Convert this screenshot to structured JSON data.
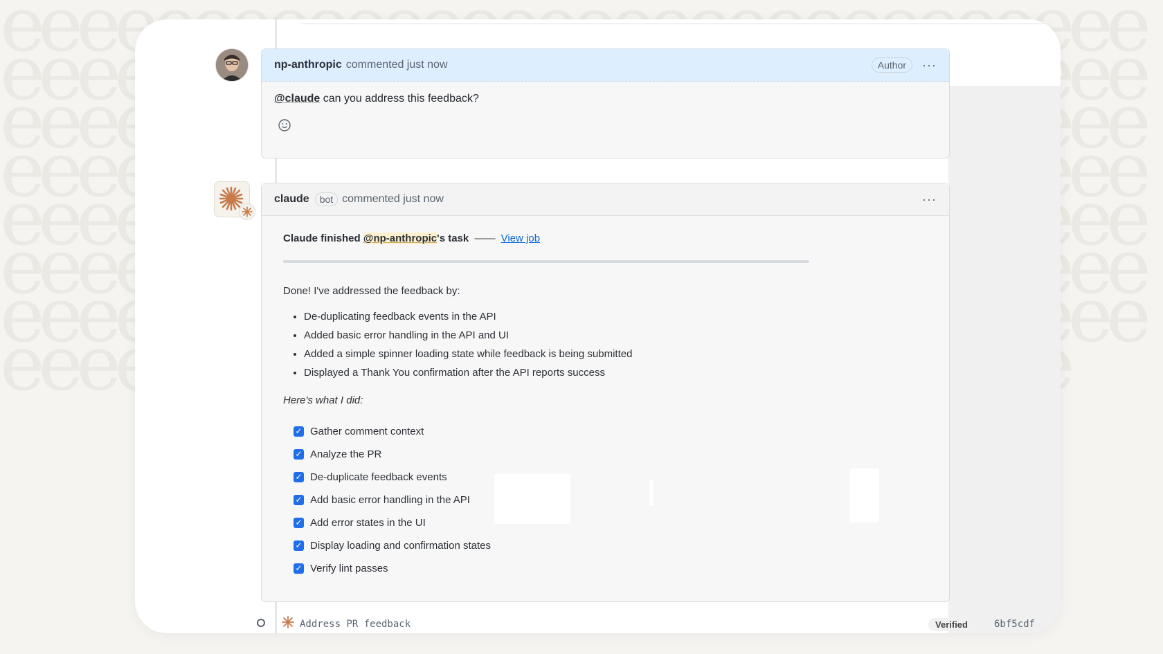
{
  "comment1": {
    "author": "np-anthropic",
    "meta": "commented just now",
    "role_badge": "Author",
    "more_label": "···",
    "mention": "@claude",
    "text": " can you address this feedback?",
    "reaction_icon": "smiley-icon"
  },
  "comment2": {
    "author": "claude",
    "bot_label": "bot",
    "meta": "commented just now",
    "more_label": "···",
    "finished_prefix": "Claude finished ",
    "finished_mention": "@np-anthropic",
    "finished_suffix": "'s task",
    "dash": "——",
    "view_job": "View job",
    "done_text": "Done! I've addressed the feedback by:",
    "bullets": [
      "De-duplicating feedback events in the API",
      "Added basic error handling in the API and UI",
      "Added a simple spinner loading state while feedback is being submitted",
      "Displayed a Thank You confirmation after the API reports success"
    ],
    "did_title": "Here's what I did:",
    "tasks": [
      "Gather comment context",
      "Analyze the PR",
      "De-duplicate feedback events",
      "Add basic error handling in the API",
      "Add error states in the UI",
      "Display loading and confirmation states",
      "Verify lint passes"
    ]
  },
  "commit": {
    "message": "Address PR feedback",
    "verified": "Verified",
    "sha": "6bf5cdf"
  },
  "colors": {
    "link": "#0969da",
    "checkbox": "#1f6feb",
    "author_header": "#ddeefe",
    "claude_accent": "#c87a4a"
  }
}
